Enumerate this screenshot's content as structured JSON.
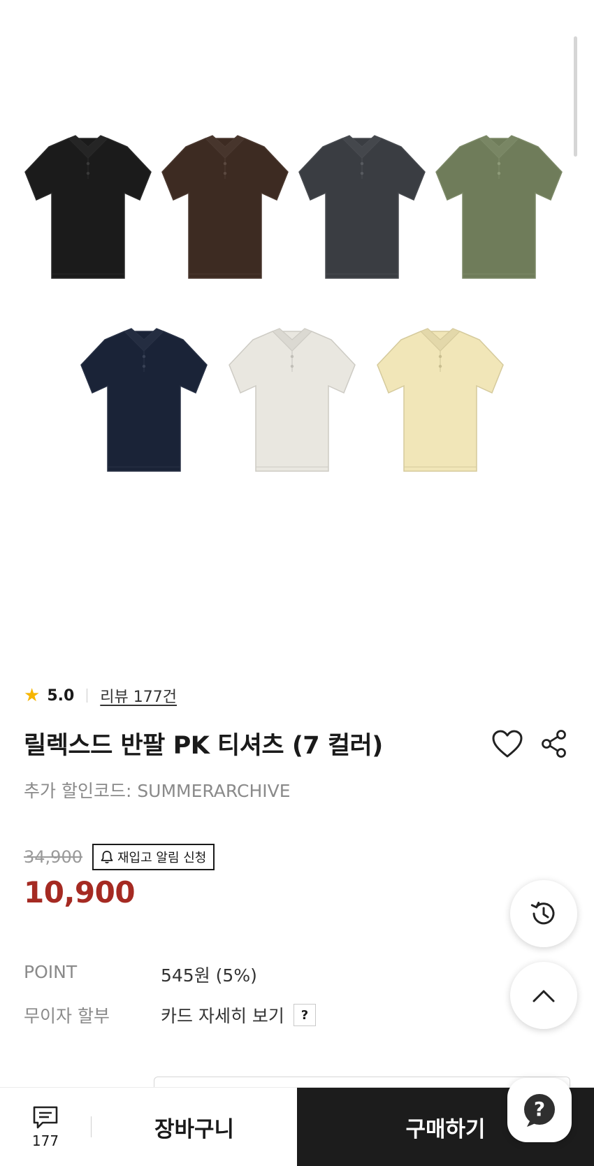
{
  "product": {
    "rating": "5.0",
    "review_link": "리뷰 177건",
    "title": "릴렉스드 반팔 PK 티셔츠 (7 컬러)",
    "discount_code": "추가 할인코드: SUMMERARCHIVE",
    "original_price": "34,900",
    "sale_price": "10,900",
    "restock_label": "재입고 알림 신청"
  },
  "gallery": {
    "colors": [
      "#1b1b1b",
      "#3d2b22",
      "#3a3d42",
      "#6f7c5a",
      "#1a2337",
      "#e9e7e0",
      "#f1e6b8"
    ]
  },
  "info": {
    "point_label": "POINT",
    "point_value": "545원 (5%)",
    "installment_label": "무이자 할부",
    "installment_value": "카드 자세히 보기",
    "help_label": "?"
  },
  "bottom_bar": {
    "review_count": "177",
    "cart_label": "장바구니",
    "buy_label": "구매하기"
  },
  "icons": {
    "star": "star-icon",
    "heart": "heart-icon",
    "share": "share-icon",
    "bell": "bell-icon",
    "history": "history-icon",
    "up": "chevron-up-icon",
    "chat": "chat-icon",
    "help": "help-icon"
  },
  "theme": {
    "sale_price_color": "#a52a22",
    "buy_button_color": "#1c1c1c",
    "star_color": "#f6b500"
  }
}
